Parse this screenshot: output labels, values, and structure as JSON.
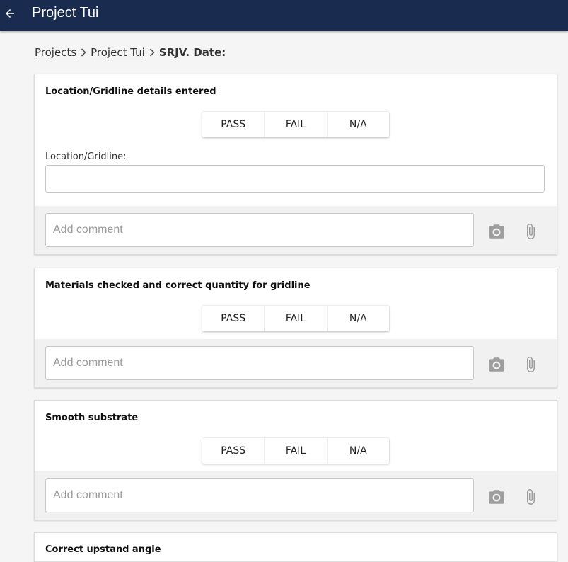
{
  "header": {
    "title": "Project Tui",
    "back_icon": "arrow-left-icon"
  },
  "breadcrumb": {
    "items": [
      "Projects",
      "Project Tui"
    ],
    "current": "SRJV. Date:"
  },
  "options": [
    "PASS",
    "FAIL",
    "N/A"
  ],
  "cards": [
    {
      "title": "Location/Gridline details entered",
      "field_label": "Location/Gridline:",
      "field_value": "",
      "comment_placeholder": "Add comment"
    },
    {
      "title": "Materials checked and correct quantity for gridline",
      "comment_placeholder": "Add comment"
    },
    {
      "title": "Smooth substrate",
      "comment_placeholder": "Add comment"
    },
    {
      "title": "Correct upstand angle"
    }
  ],
  "colors": {
    "appbar": "#1a2b50",
    "background": "#f5f5f5",
    "comment_bar": "#f1f1f1",
    "icon": "#9e9e9e"
  }
}
